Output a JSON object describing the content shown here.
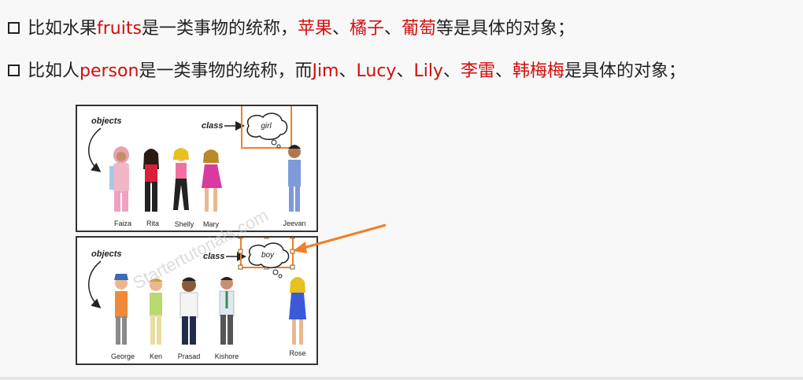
{
  "line1": {
    "p1": "比如水果",
    "term": "fruits",
    "p2": "是一类事物的统称，",
    "e1": "苹果",
    "sep1": "、",
    "e2": "橘子",
    "sep2": "、",
    "e3": "葡萄",
    "p3": "等是具体的对象；"
  },
  "line2": {
    "p1": "比如人",
    "term": "person",
    "p2": "是一类事物的统称，而",
    "e1": "Jim",
    "sep1": "、",
    "e2": "Lucy",
    "sep2": "、",
    "e3": "Lily",
    "sep3": "、",
    "e4": "李雷",
    "sep4": "、",
    "e5": "韩梅梅",
    "p3": "是具体的对象；"
  },
  "figure": {
    "top": {
      "objects_label": "objects",
      "class_label": "class",
      "class_name": "girl",
      "names": [
        "Faiza",
        "Rita",
        "Shelly",
        "Mary",
        "Jeevan"
      ]
    },
    "bottom": {
      "objects_label": "objects",
      "class_label": "class",
      "class_name": "boy",
      "names": [
        "George",
        "Ken",
        "Prasad",
        "Kishore",
        "Rose"
      ]
    },
    "watermark": "Startertutorials.com"
  },
  "colors": {
    "highlight": "#d40d0d",
    "accent": "#f07f28"
  }
}
